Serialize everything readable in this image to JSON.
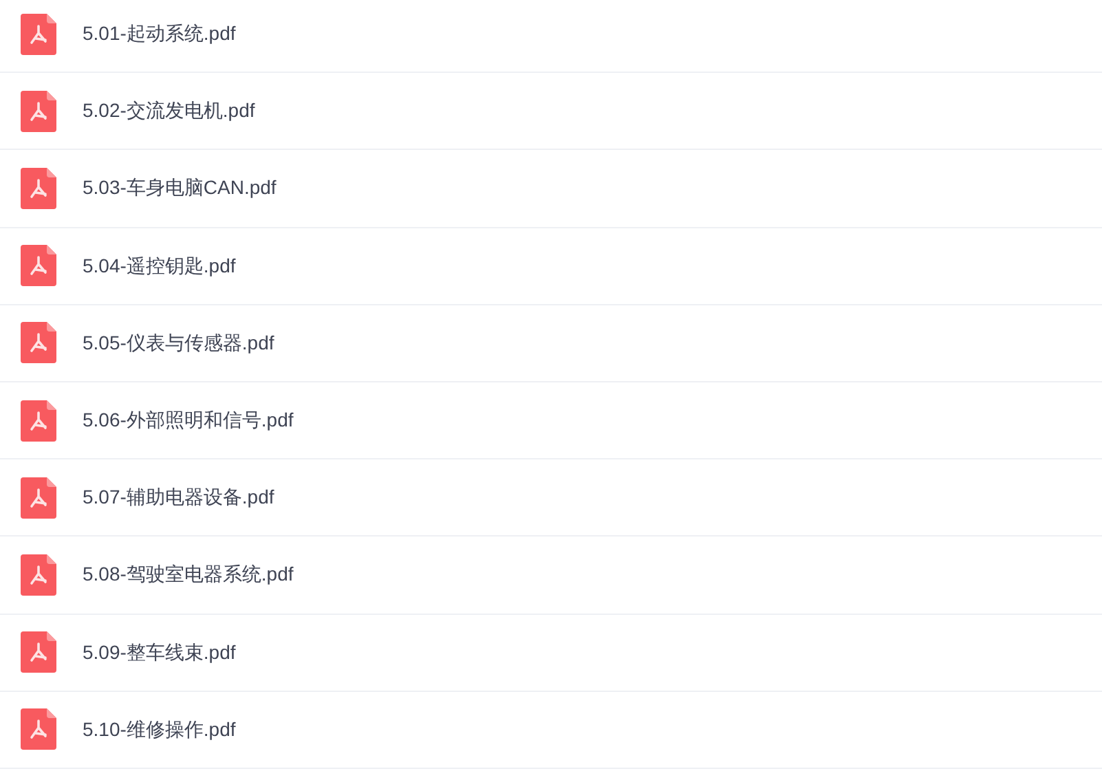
{
  "files": [
    {
      "name": "5.01-起动系统.pdf"
    },
    {
      "name": "5.02-交流发电机.pdf"
    },
    {
      "name": "5.03-车身电脑CAN.pdf"
    },
    {
      "name": "5.04-遥控钥匙.pdf"
    },
    {
      "name": "5.05-仪表与传感器.pdf"
    },
    {
      "name": "5.06-外部照明和信号.pdf"
    },
    {
      "name": "5.07-辅助电器设备.pdf"
    },
    {
      "name": "5.08-驾驶室电器系统.pdf"
    },
    {
      "name": "5.09-整车线束.pdf"
    },
    {
      "name": "5.10-维修操作.pdf"
    }
  ]
}
